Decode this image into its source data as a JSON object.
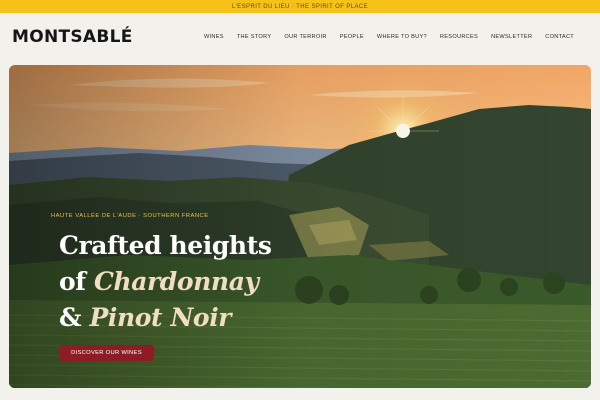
{
  "announcement": {
    "text": "L'ESPRIT DU LIEU · THE SPIRIT OF PLACE"
  },
  "brand": {
    "logo_text": "MONTSABLÉ"
  },
  "nav": {
    "items": [
      {
        "label": "WINES"
      },
      {
        "label": "THE STORY"
      },
      {
        "label": "OUR TERROIR"
      },
      {
        "label": "PEOPLE"
      },
      {
        "label": "WHERE TO BUY?"
      },
      {
        "label": "RESOURCES"
      },
      {
        "label": "NEWSLETTER"
      },
      {
        "label": "CONTACT"
      }
    ]
  },
  "hero": {
    "eyebrow": "HAUTE VALLÉE DE L'AUDE · SOUTHERN FRANCE",
    "headline_line1": "Crafted heights",
    "headline_of": "of ",
    "headline_chardonnay": "Chardonnay",
    "headline_amp": "& ",
    "headline_pinot": "Pinot Noir",
    "cta_label": "DISCOVER OUR WINES"
  },
  "colors": {
    "announcement_bg": "#f6c21a",
    "page_bg": "#f3f1ec",
    "cta_bg": "#8c1d24",
    "eyebrow": "#f1c23a"
  }
}
